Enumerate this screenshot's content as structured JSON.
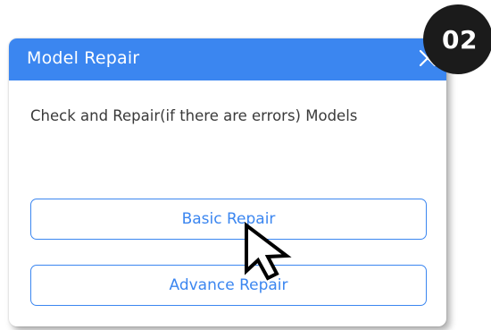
{
  "badge": {
    "label": "02"
  },
  "dialog": {
    "title": "Model Repair",
    "close_icon": "close-icon",
    "message": "Check and Repair(if there are errors) Models",
    "buttons": {
      "basic_label": "Basic Repair",
      "advance_label": "Advance Repair"
    }
  },
  "colors": {
    "accent": "#3b86f0",
    "badge_background": "#1b1b1b",
    "text": "#3a3a3a"
  },
  "cursor_icon": "pointer-arrow-icon"
}
